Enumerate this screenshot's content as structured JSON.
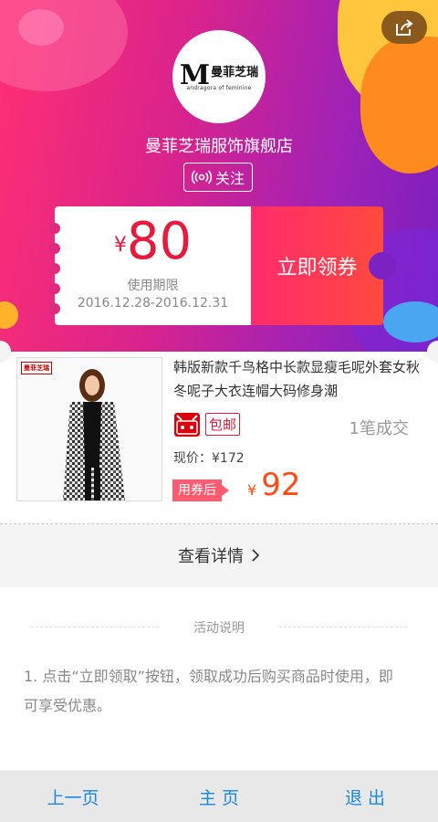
{
  "shop": {
    "logo_letter": "M",
    "logo_name": "曼菲芝瑞",
    "logo_sub": "andragora of feminine",
    "name": "曼菲芝瑞服饰旗舰店",
    "follow_label": "关注"
  },
  "coupon": {
    "currency": "¥",
    "amount": "80",
    "validity_label": "使用期限",
    "validity": "2016.12.28-2016.12.31",
    "claim_label": "立即领券"
  },
  "product": {
    "image_brand": "曼菲芝瑞",
    "title": "韩版新款千鸟格中长款显瘦毛呢外套女秋冬呢子大衣连帽大码修身潮",
    "shipping_badge": "包邮",
    "sales": "1笔成交",
    "current_price": "现价：¥172",
    "after_coupon_label": "用券后",
    "after_coupon_currency": "¥",
    "after_coupon_price": "92"
  },
  "detail_link": "查看详情",
  "activity": {
    "heading": "活动说明",
    "text": "1. 点击“立即领取”按钮，领取成功后购买商品时使用，即可享受优惠。"
  },
  "nav": {
    "prev": "上一页",
    "home": "主 页",
    "exit": "退 出"
  },
  "colors": {
    "accent_red": "#e8193c",
    "nav_blue": "#1a86e8",
    "price_orange": "#ff4a1a"
  },
  "icons": {
    "share": "share-icon",
    "follow": "radio-wave-icon",
    "chevron": "chevron-right-icon",
    "tmall": "tmall-icon"
  }
}
